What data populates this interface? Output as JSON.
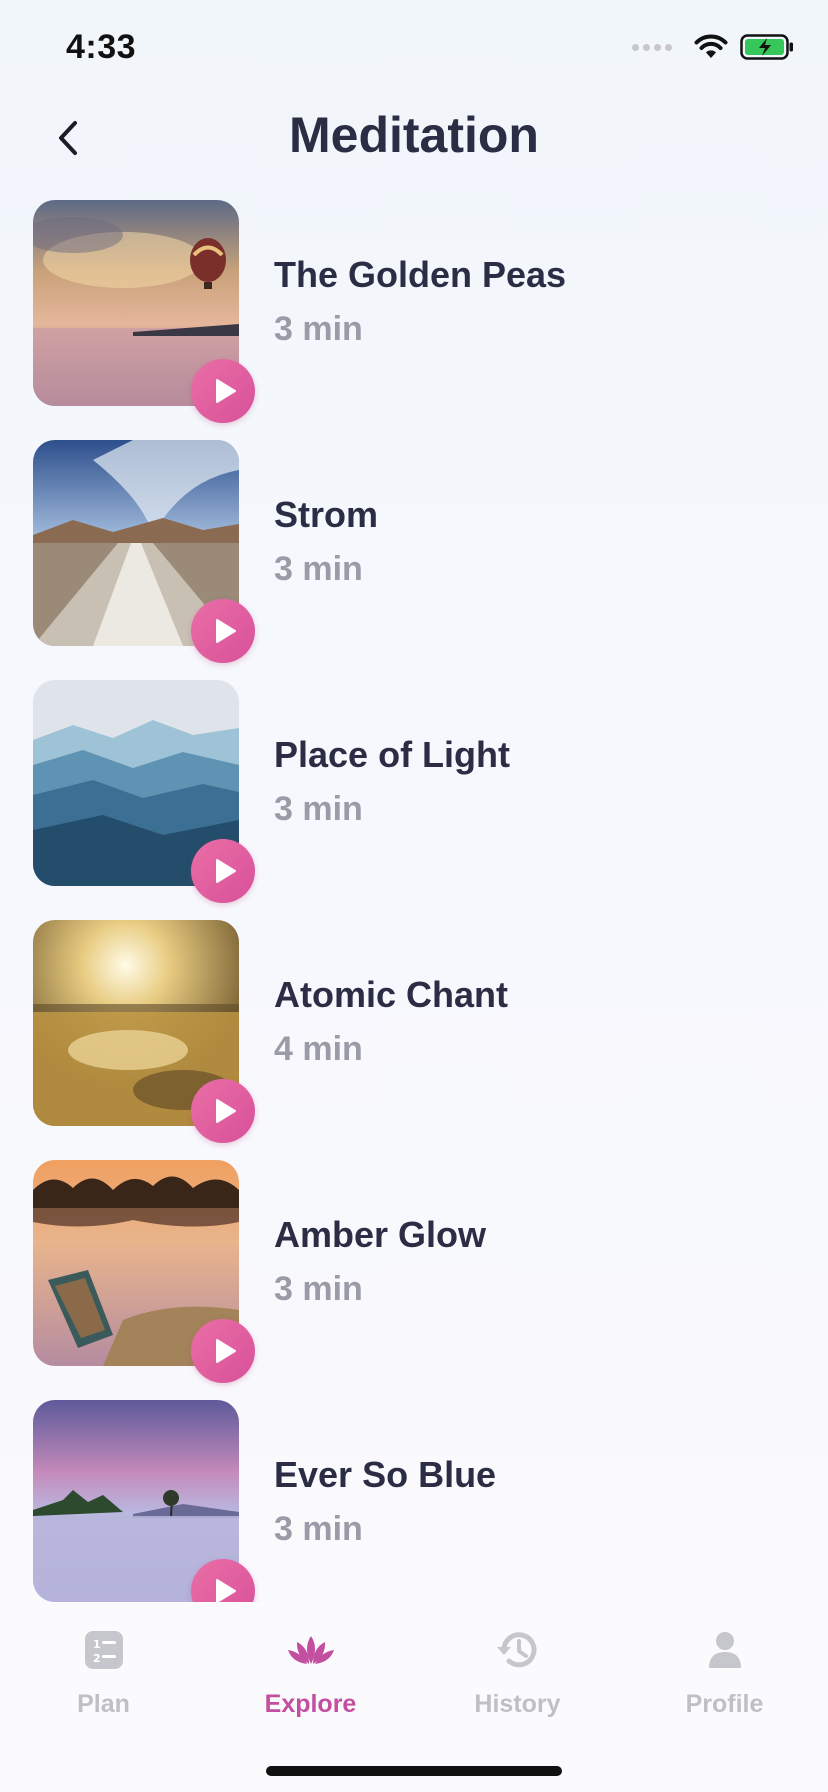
{
  "status_bar": {
    "time": "4:33"
  },
  "header": {
    "title": "Meditation"
  },
  "items": [
    {
      "title": "The Golden Peas",
      "duration": "3 min"
    },
    {
      "title": "Strom",
      "duration": "3 min"
    },
    {
      "title": "Place of Light",
      "duration": "3 min"
    },
    {
      "title": "Atomic Chant",
      "duration": "4 min"
    },
    {
      "title": "Amber Glow",
      "duration": "3 min"
    },
    {
      "title": "Ever So Blue",
      "duration": "3 min"
    }
  ],
  "tabs": [
    {
      "label": "Plan",
      "icon": "plan-icon"
    },
    {
      "label": "Explore",
      "icon": "lotus-icon",
      "active": true
    },
    {
      "label": "History",
      "icon": "history-icon"
    },
    {
      "label": "Profile",
      "icon": "profile-icon"
    }
  ],
  "colors": {
    "accent": "#c34fa1",
    "play_button": "#e0609f",
    "title_text": "#2b2d45",
    "subtitle_text": "#9a9ba6",
    "inactive_tab": "#bfc0c6"
  }
}
